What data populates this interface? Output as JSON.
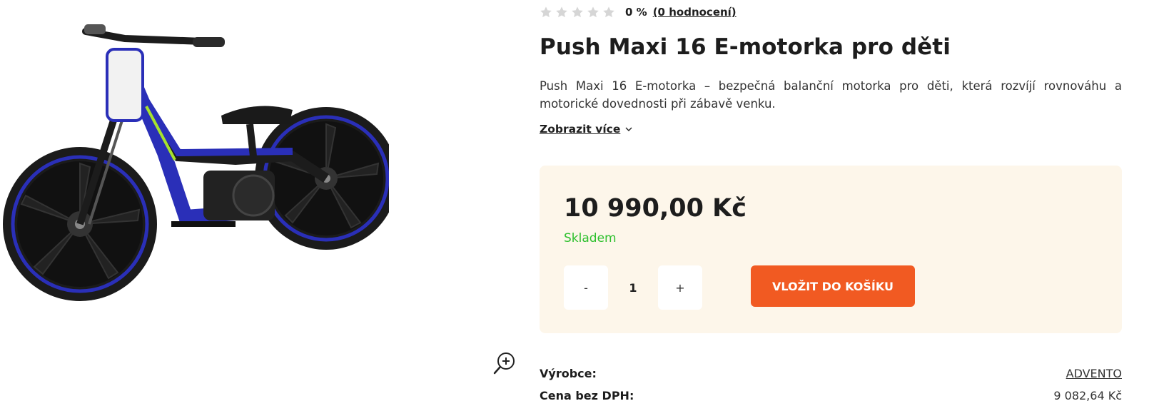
{
  "product": {
    "rating": {
      "stars_filled": 0,
      "stars_total": 5,
      "percent": "0 %",
      "count_label": "(0 hodnocení)"
    },
    "title": "Push Maxi 16 E-motorka pro děti",
    "description": "Push Maxi 16 E-motorka – bezpečná balanční motorka pro děti, která rozvíjí rovnováhu a motorické dovednosti při zábavě venku.",
    "show_more_label": "Zobrazit více",
    "price": "10 990,00 Kč",
    "stock": "Skladem",
    "quantity": {
      "minus_label": "-",
      "value": "1",
      "plus_label": "+"
    },
    "add_to_cart_label": "VLOŽIT DO KOŠÍKU",
    "specs": [
      {
        "label": "Výrobce:",
        "value": "ADVENTO"
      },
      {
        "label": "Cena bez DPH:",
        "value": "9 082,64 Kč"
      }
    ]
  },
  "colors": {
    "accent": "#f15a22",
    "stock_green": "#2ec02e",
    "buybox_bg": "#fdf6ea",
    "star_gray": "#d6d6d6"
  },
  "icons": {
    "zoom": "zoom-in-icon",
    "star": "star-icon",
    "chevron": "chevron-down-icon"
  }
}
